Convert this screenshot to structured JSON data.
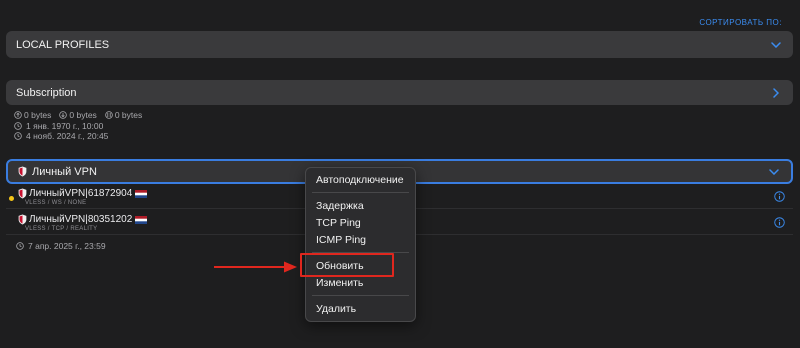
{
  "sort_label": "СОРТИРОВАТЬ ПО:",
  "local_profiles": {
    "title": "LOCAL PROFILES"
  },
  "subscription": {
    "title": "Subscription",
    "upload": "0 bytes",
    "download": "0 bytes",
    "total": "0 bytes",
    "created": "1 янв. 1970 г., 10:00",
    "updated": "4 нояб. 2024 г., 20:45"
  },
  "vpn_group": {
    "title": "Личный VPN",
    "profiles": [
      {
        "name": "ЛичныйVPN|61872904",
        "transport": "VLESS / WS / NONE",
        "active": true
      },
      {
        "name": "ЛичныйVPN|80351202",
        "transport": "VLESS / TCP / REALITY",
        "active": false
      }
    ],
    "updated": "7 апр. 2025 г., 23:59"
  },
  "context_menu": {
    "items": [
      "Автоподключение",
      "Задержка",
      "TCP Ping",
      "ICMP Ping",
      "Обновить",
      "Изменить",
      "Удалить"
    ]
  },
  "colors": {
    "accent": "#3b8cf0",
    "highlight": "#e0271e",
    "active_dot": "#f5c518"
  }
}
